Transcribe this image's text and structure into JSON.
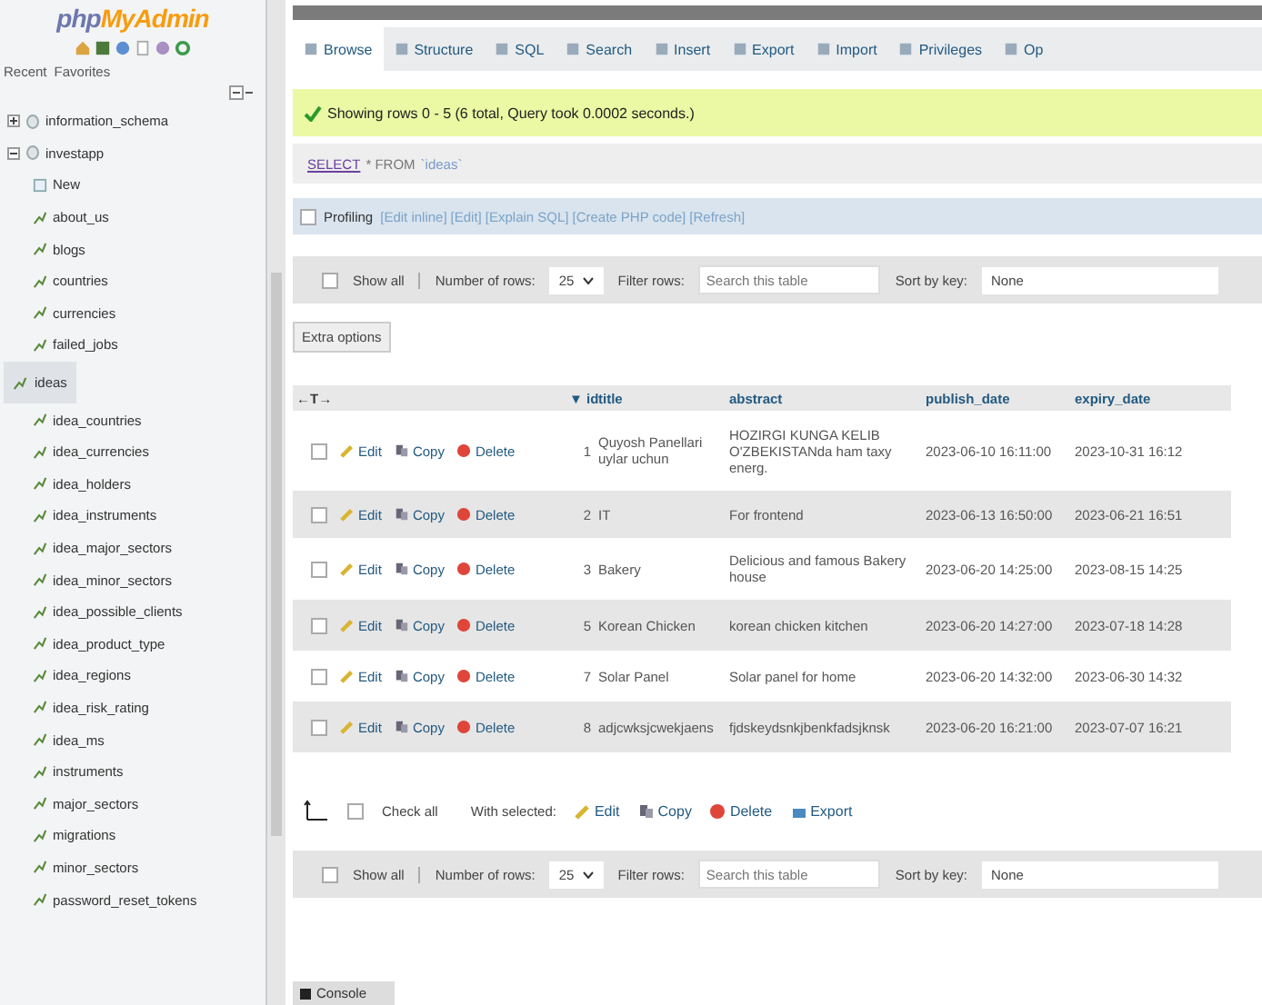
{
  "sidebar": {
    "logo_prefix": "php",
    "logo_suffix": "MyAdmin",
    "tabs": [
      {
        "label": "Recent",
        "selected": false
      },
      {
        "label": "Favorites",
        "selected": false
      }
    ],
    "tree": [
      {
        "label": "information_schema",
        "expanded": false
      },
      {
        "label": "investapp",
        "expanded": true,
        "children": [
          {
            "label": "New",
            "kind": "new",
            "selected": false
          },
          {
            "label": "about_us",
            "kind": "table",
            "selected": false
          },
          {
            "label": "blogs",
            "kind": "table",
            "selected": false
          },
          {
            "label": "countries",
            "kind": "table",
            "selected": false
          },
          {
            "label": "currencies",
            "kind": "table",
            "selected": false
          },
          {
            "label": "failed_jobs",
            "kind": "table",
            "selected": false
          },
          {
            "label": "ideas",
            "kind": "table",
            "selected": true
          },
          {
            "label": "idea_countries",
            "kind": "table",
            "selected": false
          },
          {
            "label": "idea_currencies",
            "kind": "table",
            "selected": false
          },
          {
            "label": "idea_holders",
            "kind": "table",
            "selected": false
          },
          {
            "label": "idea_instruments",
            "kind": "table",
            "selected": false
          },
          {
            "label": "idea_major_sectors",
            "kind": "table",
            "selected": false
          },
          {
            "label": "idea_minor_sectors",
            "kind": "table",
            "selected": false
          },
          {
            "label": "idea_possible_clients",
            "kind": "table",
            "selected": false
          },
          {
            "label": "idea_product_type",
            "kind": "table",
            "selected": false
          },
          {
            "label": "idea_regions",
            "kind": "table",
            "selected": false
          },
          {
            "label": "idea_risk_rating",
            "kind": "table",
            "selected": false
          },
          {
            "label": "idea_ms",
            "kind": "table",
            "selected": false
          },
          {
            "label": "instruments",
            "kind": "table",
            "selected": false
          },
          {
            "label": "major_sectors",
            "kind": "table",
            "selected": false
          },
          {
            "label": "migrations",
            "kind": "table",
            "selected": false
          },
          {
            "label": "minor_sectors",
            "kind": "table",
            "selected": false
          },
          {
            "label": "password_reset_tokens",
            "kind": "table",
            "selected": false
          }
        ]
      }
    ]
  },
  "tabs": [
    {
      "label": "Browse",
      "selected": true
    },
    {
      "label": "Structure",
      "selected": false
    },
    {
      "label": "SQL",
      "selected": false
    },
    {
      "label": "Search",
      "selected": false
    },
    {
      "label": "Insert",
      "selected": false
    },
    {
      "label": "Export",
      "selected": false
    },
    {
      "label": "Import",
      "selected": false
    },
    {
      "label": "Privileges",
      "selected": false
    },
    {
      "label": "Op",
      "selected": false
    }
  ],
  "message": "Showing rows 0 - 5 (6 total, Query took 0.0002 seconds.)",
  "query": {
    "keyword": "SELECT",
    "rest": "* FROM",
    "table": "`ideas`"
  },
  "profiling": {
    "checked": false,
    "label": "Profiling",
    "links": [
      "[Edit inline]",
      "[Edit]",
      "[Explain SQL]",
      "[Create PHP code]",
      "[Refresh]"
    ]
  },
  "nav_top": {
    "show_all": "Show all",
    "show_all_checked": false,
    "rows_label": "Number of rows:",
    "rows_value": "25",
    "filter_label": "Filter rows:",
    "placeholder": "Search this table",
    "sort_label": "Sort by key:",
    "sort_value": "None"
  },
  "extra_options": "Extra options",
  "table": {
    "options": "←T→",
    "sort_mark": "▼",
    "columns": [
      "id",
      "title",
      "abstract",
      "publish_date",
      "expiry_date"
    ],
    "rows": [
      {
        "checked": false,
        "actions": [
          "Edit",
          "Copy",
          "Delete"
        ],
        "id": "1",
        "title": "Quyosh Panellari uylar uchun",
        "abstract": "HOZIRGI KUNGA KELIB O'ZBEKISTANda ham taxy energ.",
        "publish_date": "2023-06-10 16:11:00",
        "expiry_date": "2023-10-31 16:12"
      },
      {
        "checked": false,
        "actions": [
          "Edit",
          "Copy",
          "Delete"
        ],
        "id": "2",
        "title": "IT",
        "abstract": "For frontend",
        "publish_date": "2023-06-13 16:50:00",
        "expiry_date": "2023-06-21 16:51"
      },
      {
        "checked": false,
        "actions": [
          "Edit",
          "Copy",
          "Delete"
        ],
        "id": "3",
        "title": "Bakery",
        "abstract": "Delicious and famous Bakery house",
        "publish_date": "2023-06-20 14:25:00",
        "expiry_date": "2023-08-15 14:25"
      },
      {
        "checked": false,
        "actions": [
          "Edit",
          "Copy",
          "Delete"
        ],
        "id": "5",
        "title": "Korean Chicken",
        "abstract": "korean chicken kitchen",
        "publish_date": "2023-06-20 14:27:00",
        "expiry_date": "2023-07-18 14:28"
      },
      {
        "checked": false,
        "actions": [
          "Edit",
          "Copy",
          "Delete"
        ],
        "id": "7",
        "title": "Solar Panel",
        "abstract": "Solar panel for home",
        "publish_date": "2023-06-20 14:32:00",
        "expiry_date": "2023-06-30 14:32"
      },
      {
        "checked": false,
        "actions": [
          "Edit",
          "Copy",
          "Delete"
        ],
        "id": "8",
        "title": "adjcwksjcwekjaens",
        "abstract": "fjdskeydsnkjbenkfadsjknsk",
        "publish_date": "2023-06-20 16:21:00",
        "expiry_date": "2023-07-07 16:21"
      }
    ]
  },
  "bulk": {
    "check_all": "Check all",
    "check_all_checked": false,
    "with_selected": "With selected:",
    "actions": [
      "Edit",
      "Copy",
      "Delete",
      "Export"
    ]
  },
  "nav_bottom": {
    "show_all": "Show all",
    "show_all_checked": false,
    "rows_label": "Number of rows:",
    "rows_value": "25",
    "filter_label": "Filter rows:",
    "placeholder": "Search this table",
    "sort_label": "Sort by key:",
    "sort_value": "None"
  },
  "console": "Console"
}
